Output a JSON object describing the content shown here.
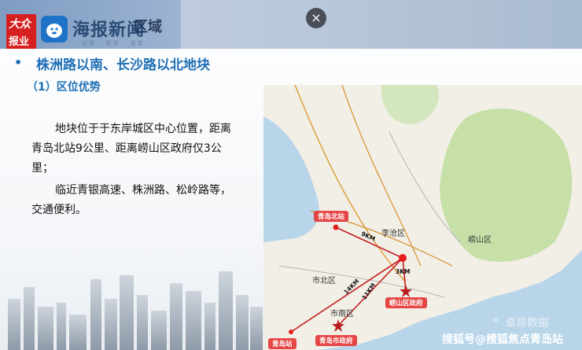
{
  "header": {
    "title": "区域",
    "logo_top": "大众",
    "logo_bottom": "报业",
    "logo_name": "海报新闻",
    "logo_sub": "这里 · 新闻 · 温度"
  },
  "close_label": "×",
  "section": {
    "bullet": "•",
    "title": "株洲路以南、长沙路以北地块",
    "subtitle": "（1）区位优势"
  },
  "paragraphs": [
    "地块位于于东岸城区中心位置，距离青岛北站9公里、距离崂山区政府仅3公里；",
    "临近青银高速、株洲路、松岭路等，交通便利。"
  ],
  "map": {
    "areas": {
      "licang": "李沧区",
      "laoshan": "崂山区",
      "shibei": "市北区",
      "shinan": "市南区"
    },
    "tags": {
      "north_station": "青岛北站",
      "laoshan_gov": "崂山区政府",
      "city_gov": "青岛市政府",
      "station": "青岛站"
    },
    "distances": {
      "d1": "9KM",
      "d2": "3KM",
      "d3": "14KM",
      "d4": "11KM"
    }
  },
  "watermarks": {
    "corner": "卓易数据",
    "bottom": "搜狐号@搜狐焦点青岛站"
  },
  "colors": {
    "accent": "#1f6fb5",
    "route": "#c41f1f",
    "tag": "#e64545"
  }
}
